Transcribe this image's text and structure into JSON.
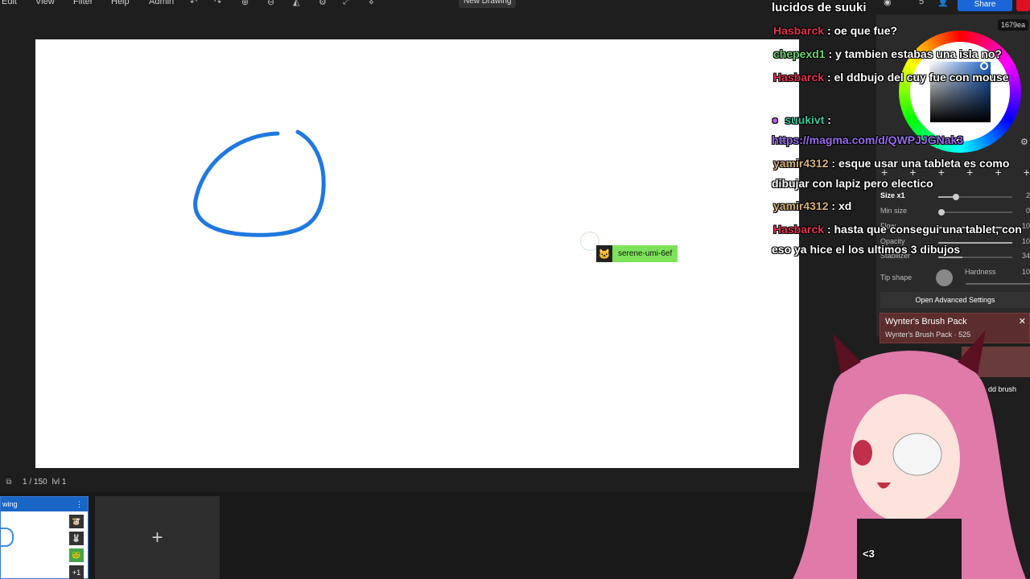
{
  "menu": {
    "edit": "Edit",
    "view": "View",
    "filter": "Filter",
    "help": "Help",
    "admin": "Admin"
  },
  "toolbar_icons": [
    "undo-icon",
    "redo-icon",
    "zoom-in-icon",
    "zoom-out-icon",
    "flip-icon",
    "settings-icon",
    "fullscreen-icon",
    "grid-icon"
  ],
  "document": {
    "title": "New Drawing"
  },
  "canvas": {
    "remote_user": "serene-umi-6ef",
    "stroke_color": "#1f78e0"
  },
  "status": {
    "frame": "1 / 150",
    "level": "lvl 1"
  },
  "frames": {
    "card_title": "wing",
    "menu": "⋮",
    "thumb_more": "+1",
    "add_label": "+"
  },
  "header_right": {
    "viewer_count": "5",
    "share": "Share",
    "badge": "1679ea"
  },
  "chat": {
    "title": "lucidos de suuki",
    "messages": [
      {
        "user": "Hasbarck",
        "text": ": oe que fue?"
      },
      {
        "user": "chepexd1",
        "text": ": y tambien estabas una isla no?"
      },
      {
        "user": "Hasbarck",
        "text": ": el ddbujo del cuy fue con mouse"
      },
      {
        "user": "suukivt",
        "text": ":"
      },
      {
        "link": "https://magma.com/d/QWPJJGNak3"
      },
      {
        "user": "yamir4312",
        "text": ": esque usar una tableta es como dibujar con lapiz pero electico"
      },
      {
        "user": "yamir4312",
        "text": ": xd"
      },
      {
        "user": "Hasbarck",
        "text": ": hasta que consegui una tablet, con eso ya hice el los ultimos 3 dibujos"
      }
    ]
  },
  "brush": {
    "tab_labels": [
      "+",
      "+",
      "+",
      "+",
      "+",
      "+"
    ],
    "size_label": "Size x1",
    "size_value": "2",
    "min_size_label": "Min size",
    "min_size_value": "0",
    "flow_label": "Flow",
    "flow_value": "10",
    "opacity_label": "Opacity",
    "opacity_value": "10",
    "stabilizer_label": "Stabilizer",
    "stabilizer_value": "34",
    "tip_shape_label": "Tip shape",
    "hardness_label": "Hardness",
    "hardness_value": "10",
    "advanced_label": "Open Advanced Settings",
    "pack_title": "Wynter's Brush Pack",
    "pack_sub": "Wynter's Brush Pack · 525",
    "add_brush": "dd brush"
  },
  "overlay": {
    "heart_text": "<3"
  }
}
